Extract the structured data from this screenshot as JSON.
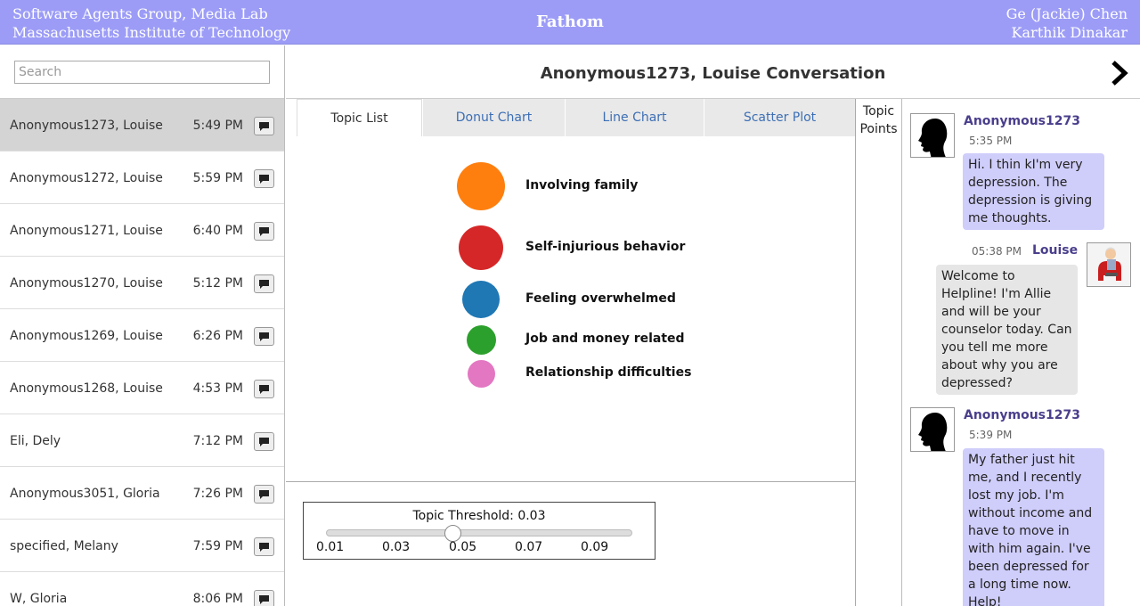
{
  "header": {
    "left_line1": "Software Agents Group, Media Lab",
    "left_line2": "Massachusetts Institute of Technology",
    "title": "Fathom",
    "right_line1": "Ge (Jackie) Chen",
    "right_line2": "Karthik Dinakar"
  },
  "search": {
    "placeholder": "Search",
    "value": ""
  },
  "conversations": [
    {
      "name": "Anonymous1273, Louise",
      "time": "5:49 PM"
    },
    {
      "name": "Anonymous1272, Louise",
      "time": "5:59 PM"
    },
    {
      "name": "Anonymous1271, Louise",
      "time": "6:40 PM"
    },
    {
      "name": "Anonymous1270, Louise",
      "time": "5:12 PM"
    },
    {
      "name": "Anonymous1269, Louise",
      "time": "6:26 PM"
    },
    {
      "name": "Anonymous1268, Louise",
      "time": "4:53 PM"
    },
    {
      "name": "Eli, Dely",
      "time": "7:12 PM"
    },
    {
      "name": "Anonymous3051, Gloria",
      "time": "7:26 PM"
    },
    {
      "name": "specified, Melany",
      "time": "7:59 PM"
    },
    {
      "name": "W, Gloria",
      "time": "8:06 PM"
    }
  ],
  "conversation": {
    "title": "Anonymous1273, Louise Conversation",
    "next_icon": "chevron-right-icon"
  },
  "tabs": [
    "Topic List",
    "Donut Chart",
    "Line Chart",
    "Scatter Plot"
  ],
  "topics": [
    {
      "label": "Involving family",
      "color": "#ff7f0e",
      "weight": 1.0
    },
    {
      "label": "Self-injurious behavior",
      "color": "#d62728",
      "weight": 0.85
    },
    {
      "label": "Feeling overwhelmed",
      "color": "#1f77b4",
      "weight": 0.6
    },
    {
      "label": "Job and money related",
      "color": "#2ca02c",
      "weight": 0.38
    },
    {
      "label": "Relationship difficulties",
      "color": "#e377c2",
      "weight": 0.32
    }
  ],
  "threshold": {
    "title": "Topic Threshold: 0.03",
    "value": 0.03,
    "min": 0.01,
    "max": 0.1,
    "ticks": [
      "0.01",
      "0.03",
      "0.05",
      "0.07",
      "0.09"
    ]
  },
  "topic_points": {
    "line1": "Topic",
    "line2": "Points"
  },
  "messages": [
    {
      "sender": "Anonymous1273",
      "time": "5:35 PM",
      "role": "user",
      "text": "Hi. I thin kI'm very depression. The depression is giving me thoughts."
    },
    {
      "sender": "Louise",
      "time": "05:38 PM",
      "role": "counselor",
      "text": "Welcome to Helpline! I'm Allie and will be your counselor today. Can you tell me more about why you are depressed?"
    },
    {
      "sender": "Anonymous1273",
      "time": "5:39 PM",
      "role": "user",
      "text": "My father just hit me, and I recently lost my job. I'm without income and have to move in with him again. I've been depressed for a long time now. Help!"
    }
  ]
}
